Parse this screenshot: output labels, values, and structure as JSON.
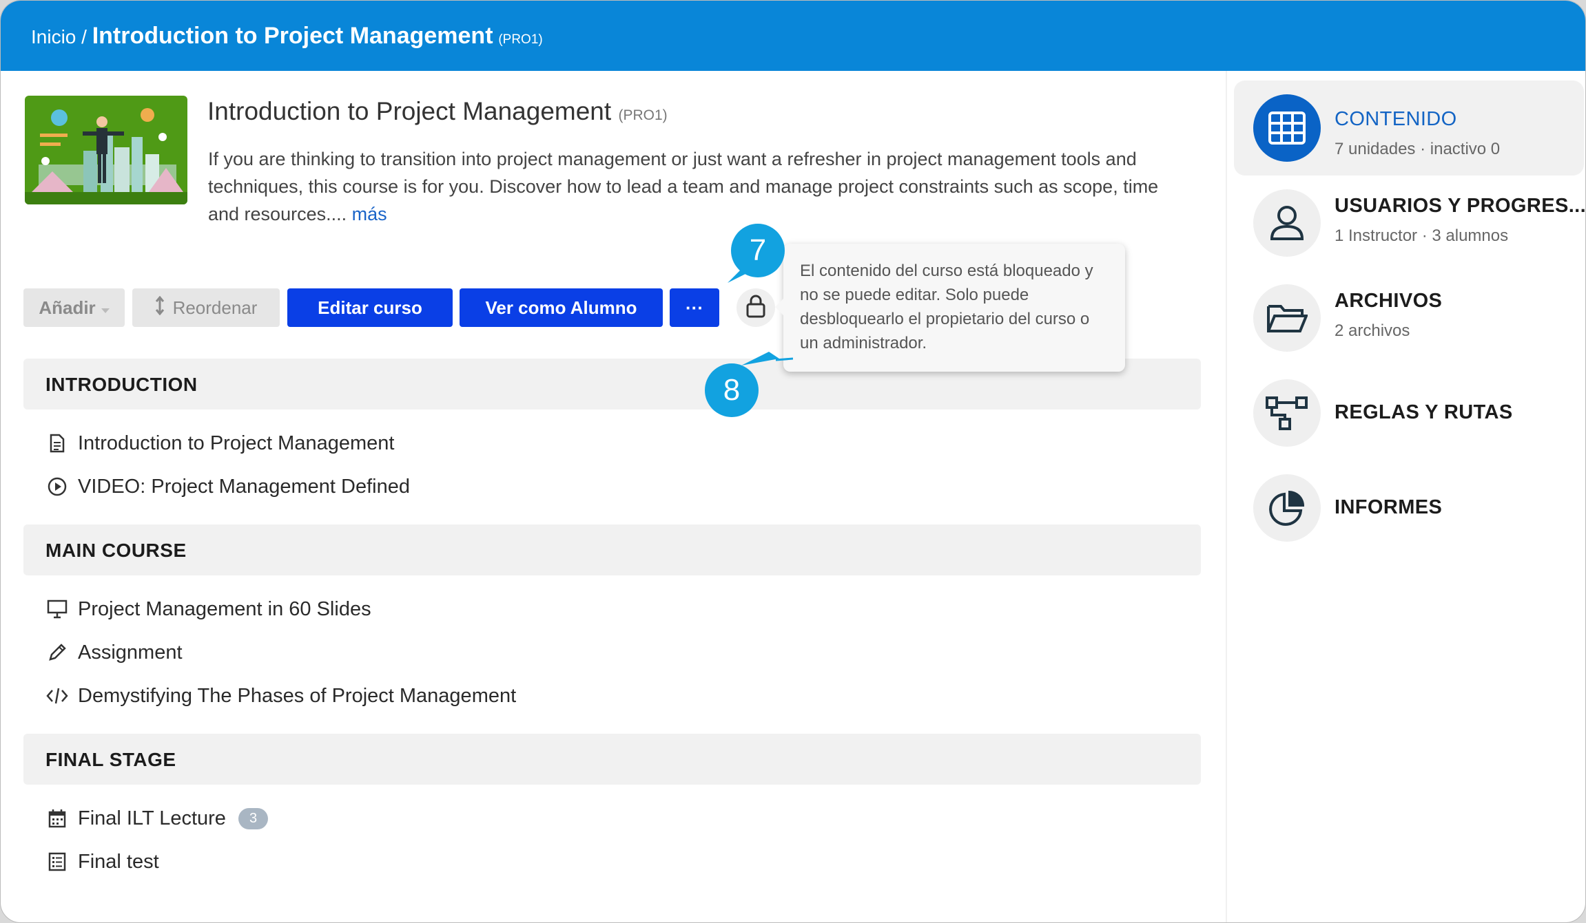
{
  "breadcrumb": {
    "home": "Inicio",
    "separator": " / ",
    "current": "Introduction to Project Management",
    "code": "(PRO1)"
  },
  "course": {
    "title": "Introduction to Project Management",
    "code": "(PRO1)",
    "description": "If you are thinking to transition into project management or just want a refresher in project management tools and techniques, this course is for you. Discover how to lead a team and manage project constraints such as scope, time and resources.... ",
    "more_link": "más"
  },
  "toolbar": {
    "add_label": "Añadir",
    "reorder_label": "Reordenar",
    "edit_label": "Editar curso",
    "view_as_student_label": "Ver como Alumno",
    "more_label": "···"
  },
  "tooltip": {
    "text": "El contenido del curso está bloqueado y no se puede editar. Solo puede desbloquearlo el propietario del curso o un administrador."
  },
  "callouts": {
    "a": "7",
    "b": "8"
  },
  "sections": [
    {
      "title": "INTRODUCTION",
      "items": [
        {
          "label": "Introduction to Project Management",
          "icon": "document-icon"
        },
        {
          "label": "VIDEO: Project Management Defined",
          "icon": "play-icon"
        }
      ]
    },
    {
      "title": "MAIN COURSE",
      "items": [
        {
          "label": "Project Management in 60 Slides",
          "icon": "presentation-icon"
        },
        {
          "label": "Assignment",
          "icon": "pencil-icon"
        },
        {
          "label": "Demystifying The Phases of Project Management",
          "icon": "code-icon"
        }
      ]
    },
    {
      "title": "FINAL STAGE",
      "items": [
        {
          "label": "Final ILT Lecture",
          "icon": "calendar-icon",
          "badge": "3"
        },
        {
          "label": "Final test",
          "icon": "checklist-icon"
        }
      ]
    }
  ],
  "sidebar": {
    "items": [
      {
        "label": "CONTENIDO",
        "sub": "7 unidades · inactivo 0",
        "icon": "grid-icon",
        "active": true
      },
      {
        "label": "USUARIOS Y PROGRES...",
        "sub": "1 Instructor · 3 alumnos",
        "icon": "user-icon"
      },
      {
        "label": "ARCHIVOS",
        "sub": "2 archivos",
        "icon": "folder-icon"
      },
      {
        "label": "REGLAS Y RUTAS",
        "icon": "flow-icon"
      },
      {
        "label": "INFORMES",
        "icon": "pie-chart-icon"
      }
    ]
  },
  "colors": {
    "topbar": "#0986d8",
    "primary_button": "#0a3fe6",
    "callout": "#12a2e0",
    "active_icon": "#0a63c6"
  }
}
